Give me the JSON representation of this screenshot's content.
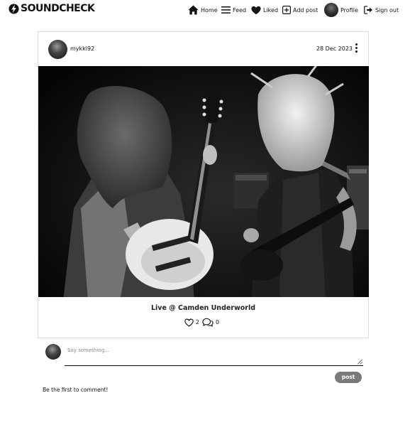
{
  "brand": {
    "name": "SOUNDCHECK"
  },
  "nav": {
    "home": "Home",
    "feed": "Feed",
    "liked": "Liked",
    "add_post": "Add post",
    "profile": "Profile",
    "sign_out": "Sign out"
  },
  "post": {
    "author": "mykki92",
    "date": "28 Dec 2023",
    "title": "Live @ Camden Underworld",
    "likes_count": "2",
    "comments_count": "0",
    "image_description_icon": "photo-two-guitarists"
  },
  "comment_form": {
    "placeholder": "Say something...",
    "value": "",
    "submit_label": "post"
  },
  "comments": {
    "empty_message": "Be the first to comment!"
  },
  "colors": {
    "text": "#111111",
    "button_bg": "#7a7a7a",
    "border": "#dcdcdc"
  },
  "icons": {
    "logo": "lightning-disc-icon",
    "home": "house-icon",
    "feed": "hamburger-list-icon",
    "liked": "heart-filled-icon",
    "add_post": "plus-square-icon",
    "sign_out": "sign-out-icon",
    "like": "heart-outline-icon",
    "comments": "speech-bubbles-icon",
    "more": "kebab-vertical-icon"
  }
}
